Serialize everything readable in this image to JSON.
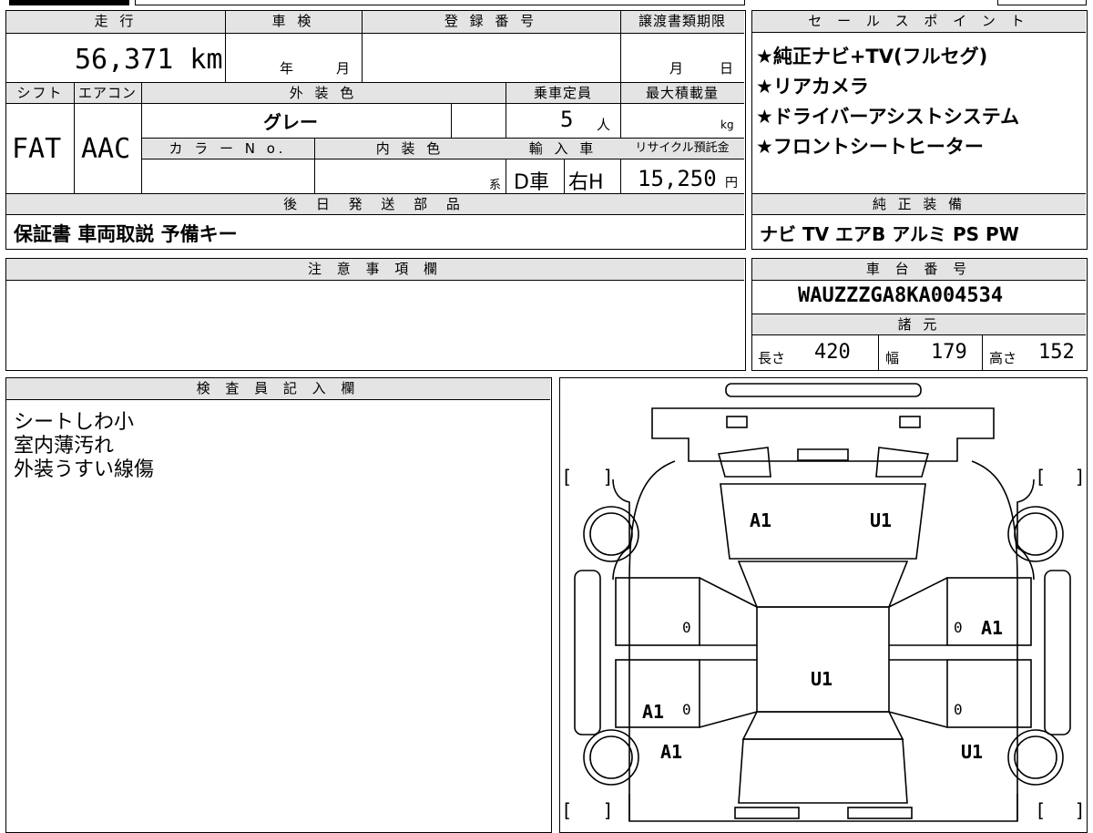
{
  "top_table": {
    "headers": {
      "mileage": "走 行",
      "inspection": "車 検",
      "registration": "登 録 番 号",
      "transfer_deadline": "譲渡書類期限",
      "shift": "シフト",
      "aircon": "エアコン",
      "exterior_color": "外 装 色",
      "capacity": "乗車定員",
      "max_load": "最大積載量",
      "color_no": "カ ラ ー N o.",
      "interior_color": "内 装 色",
      "import": "輸 入 車",
      "recycle": "リサイクル預託金",
      "parts": "後 日 発 送 部 品"
    },
    "values": {
      "mileage": "56,371 km",
      "inspection_year": "年",
      "inspection_month": "月",
      "deadline_month": "月",
      "deadline_day": "日",
      "shift": "FAT",
      "aircon": "AAC",
      "exterior_color": "グレー",
      "capacity_num": "5",
      "capacity_unit": "人",
      "max_load_unit": "kg",
      "interior_suffix": "系",
      "import_type": "D車",
      "handle": "右H",
      "recycle_fee": "15,250",
      "recycle_unit": "円",
      "parts": "保証書 車両取説 予備キー"
    }
  },
  "sales_points": {
    "header": "セ ー ル ス ポ イ ン ト",
    "items": [
      "★純正ナビ+TV(フルセグ)",
      "★リアカメラ",
      "★ドライバーアシストシステム",
      "★フロントシートヒーター"
    ]
  },
  "genuine_equipment": {
    "header": "純 正 装 備",
    "items": "ナビ TV エアB アルミ PS PW"
  },
  "notes": {
    "header": "注 意 事 項 欄",
    "text": ""
  },
  "chassis": {
    "header": "車 台 番 号",
    "number": "WAUZZZGA8KA004534"
  },
  "specs": {
    "header": "諸 元",
    "length_label": "長さ",
    "length": "420",
    "width_label": "幅",
    "width": "179",
    "height_label": "高さ",
    "height": "152"
  },
  "inspector": {
    "header": "検 査 員 記 入 欄",
    "lines": [
      "シートしわ小",
      "室内薄汚れ",
      "外装うすい線傷"
    ]
  },
  "diagram": {
    "marks": [
      {
        "code": "A1"
      },
      {
        "code": "U1"
      },
      {
        "code": "0"
      },
      {
        "code": "0"
      },
      {
        "code": "A1"
      },
      {
        "code": "U1"
      },
      {
        "code": "A1"
      },
      {
        "code": "0"
      },
      {
        "code": "0"
      },
      {
        "code": "A1"
      },
      {
        "code": "U1"
      }
    ],
    "bracket_open": "[",
    "bracket_close": "]"
  }
}
